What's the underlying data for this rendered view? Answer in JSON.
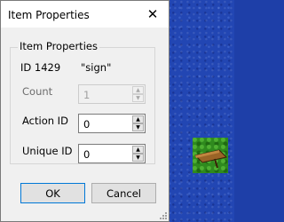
{
  "dialog": {
    "title": "Item Properties",
    "close_glyph": "✕",
    "group": {
      "legend": "Item Properties",
      "id_label": "ID 1429",
      "name": "\"sign\"",
      "count": {
        "label": "Count",
        "value": "1"
      },
      "action_id": {
        "label": "Action ID",
        "value": "0"
      },
      "unique_id": {
        "label": "Unique ID",
        "value": "0"
      }
    },
    "buttons": {
      "ok": "OK",
      "cancel": "Cancel"
    }
  },
  "icons": {
    "spin_up": "▲",
    "spin_down": "▼"
  },
  "colors": {
    "water": "#2246b3",
    "grass": "#2f8a1e",
    "sign_wood": "#8b5a1e"
  }
}
